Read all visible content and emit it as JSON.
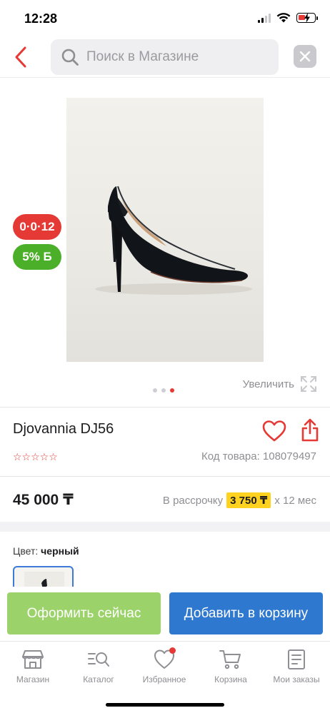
{
  "status_bar": {
    "time": "12:28"
  },
  "search": {
    "placeholder": "Поиск в Магазине",
    "value": ""
  },
  "badges": {
    "countdown": "0·0·12",
    "cashback": "5% Б"
  },
  "gallery": {
    "zoom_label": "Увеличить",
    "total_images": 3,
    "active_image": 3
  },
  "product": {
    "title": "Djovannia DJ56",
    "rating_stars": "☆☆☆☆☆",
    "sku": "Код товара: 108079497",
    "price": "45 000 ₸",
    "installment_prefix": "В рассрочку",
    "installment_amount": "3 750 ₸",
    "installment_suffix": "х 12 мес",
    "color_label": "Цвет:",
    "color_value": "черный"
  },
  "actions": {
    "order_now": "Оформить сейчас",
    "add_to_cart": "Добавить в корзину"
  },
  "tabbar": {
    "items": [
      {
        "label": "Магазин",
        "icon": "shop-icon"
      },
      {
        "label": "Каталог",
        "icon": "catalog-search-icon"
      },
      {
        "label": "Избранное",
        "icon": "heart-icon"
      },
      {
        "label": "Корзина",
        "icon": "cart-icon"
      },
      {
        "label": "Мои заказы",
        "icon": "orders-icon"
      }
    ]
  },
  "colors": {
    "accent_red": "#e53935",
    "cta_green": "#9bd36a",
    "cta_blue": "#2f78cf",
    "highlight_yellow": "#ffd21f"
  }
}
